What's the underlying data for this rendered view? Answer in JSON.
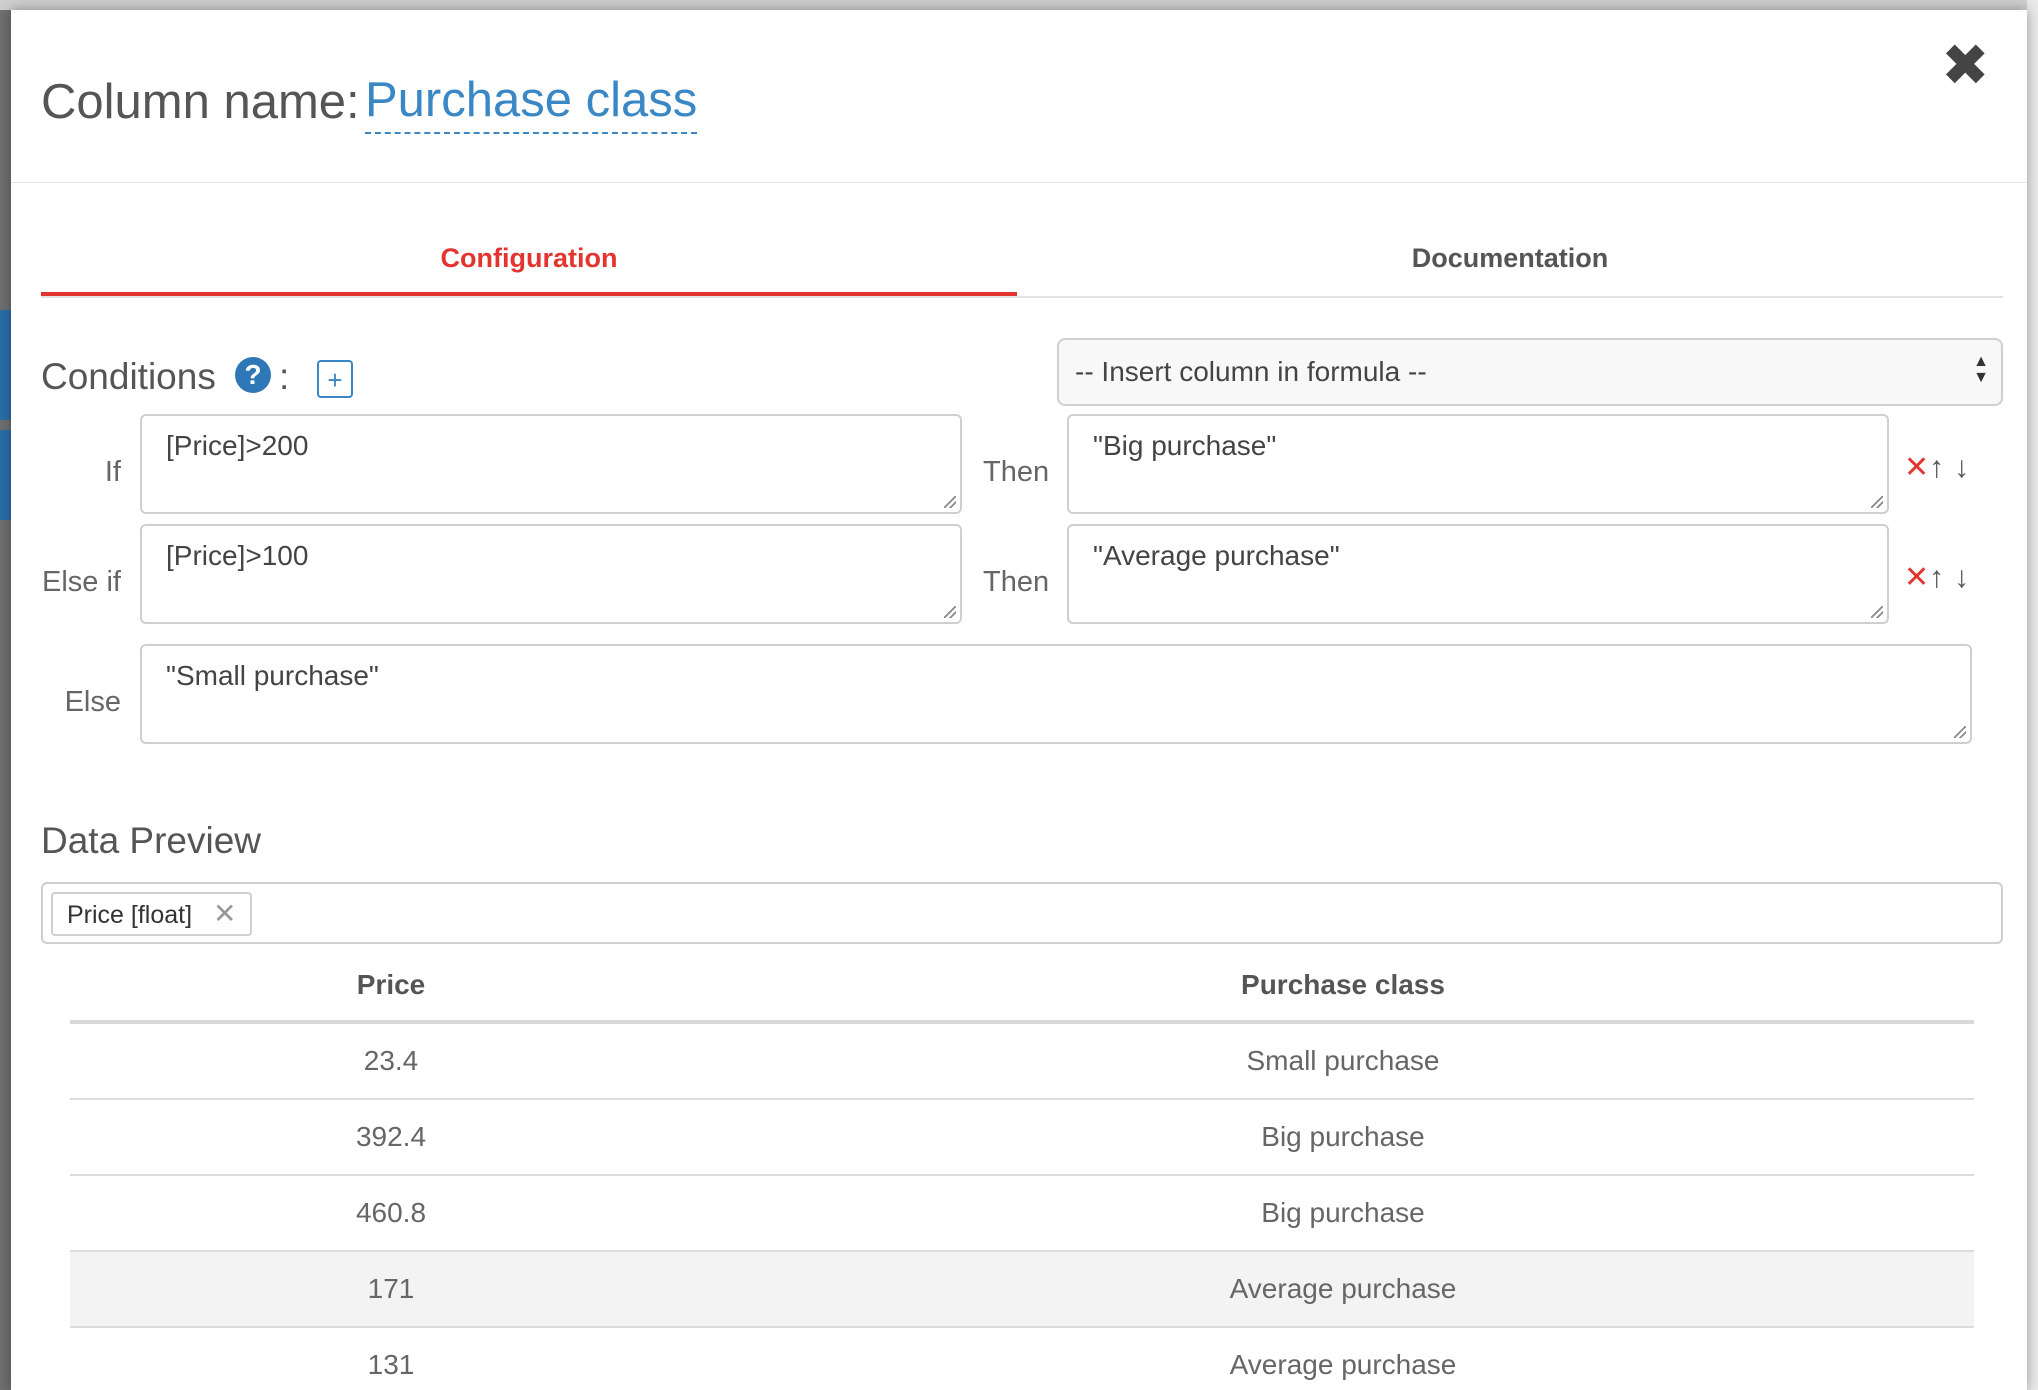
{
  "modal": {
    "title_label": "Column name:",
    "title_value": "Purchase class",
    "close_symbol": "✖"
  },
  "tabs": [
    {
      "label": "Configuration",
      "active": true
    },
    {
      "label": "Documentation",
      "active": false
    }
  ],
  "conditions": {
    "label": "Conditions",
    "help_symbol": "?",
    "colon": ":",
    "add_symbol": "+",
    "insert_select": "-- Insert column in formula --",
    "then_label": "Then",
    "rows": [
      {
        "label": "If",
        "condition": "[Price]>200",
        "result": "\"Big purchase\""
      },
      {
        "label": "Else if",
        "condition": "[Price]>100",
        "result": "\"Average purchase\""
      }
    ],
    "else": {
      "label": "Else",
      "result": "\"Small purchase\""
    },
    "action_symbols": {
      "delete": "✕",
      "up": "↑",
      "down": "↓"
    }
  },
  "preview": {
    "label": "Data Preview",
    "chip": {
      "label": "Price [float]",
      "remove_symbol": "✕"
    },
    "columns": [
      "Price",
      "Purchase class"
    ],
    "rows": [
      [
        "23.4",
        "Small purchase"
      ],
      [
        "392.4",
        "Big purchase"
      ],
      [
        "460.8",
        "Big purchase"
      ],
      [
        "171",
        "Average purchase"
      ],
      [
        "131",
        "Average purchase"
      ]
    ]
  },
  "colors": {
    "accent_red": "#e3342f",
    "link_blue": "#3a87c6",
    "help_blue": "#2f78b7"
  }
}
